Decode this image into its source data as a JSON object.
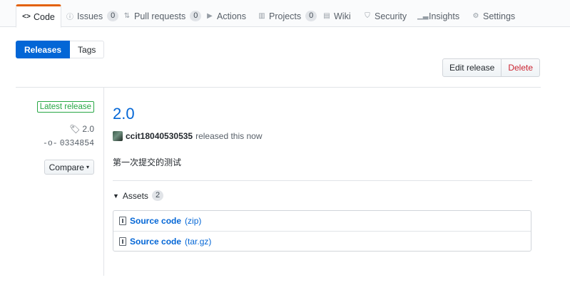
{
  "tabs": [
    {
      "label": "Code",
      "icon": "code-icon",
      "selected": true
    },
    {
      "label": "Issues",
      "icon": "issue-icon",
      "count": "0"
    },
    {
      "label": "Pull requests",
      "icon": "pull-request-icon",
      "count": "0"
    },
    {
      "label": "Actions",
      "icon": "play-icon"
    },
    {
      "label": "Projects",
      "icon": "project-icon",
      "count": "0"
    },
    {
      "label": "Wiki",
      "icon": "book-icon"
    },
    {
      "label": "Security",
      "icon": "shield-icon"
    },
    {
      "label": "Insights",
      "icon": "graph-icon"
    },
    {
      "label": "Settings",
      "icon": "gear-icon"
    }
  ],
  "subnav": {
    "releases": "Releases",
    "tags": "Tags"
  },
  "actions": {
    "edit": "Edit release",
    "delete": "Delete"
  },
  "meta": {
    "badge": "Latest release",
    "tag": "2.0",
    "commit": "0334854",
    "compare": "Compare"
  },
  "release": {
    "title": "2.0",
    "author": "ccit18040530535",
    "released_text": "released this now",
    "description": "第一次提交的测试"
  },
  "assets": {
    "label": "Assets",
    "count": "2",
    "items": [
      {
        "name": "Source code",
        "ext": "(zip)"
      },
      {
        "name": "Source code",
        "ext": "(tar.gz)"
      }
    ]
  },
  "colors": {
    "accent": "#0366d6",
    "tab_underline": "#e36209",
    "latest_badge": "#28a745",
    "delete": "#cb2431"
  }
}
